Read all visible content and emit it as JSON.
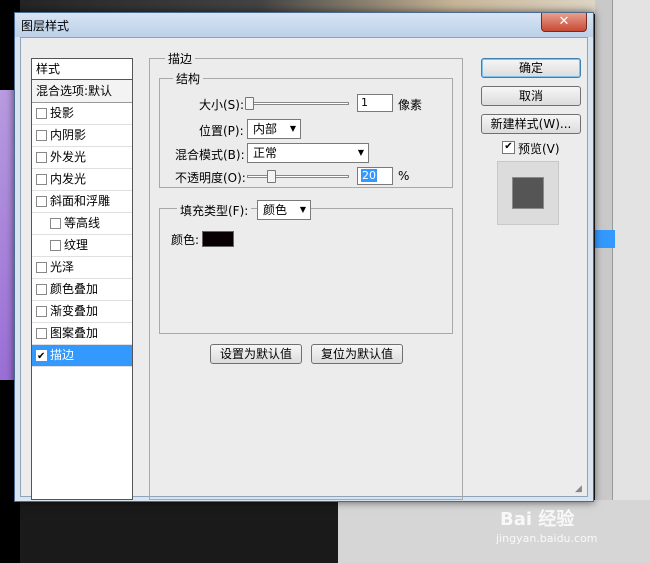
{
  "dialog": {
    "title": "图层样式",
    "close_label": "✕"
  },
  "styles_panel": {
    "header": "样式",
    "blend_options": "混合选项:默认",
    "items": [
      {
        "label": "投影",
        "checked": false,
        "indent": false,
        "selected": false
      },
      {
        "label": "内阴影",
        "checked": false,
        "indent": false,
        "selected": false
      },
      {
        "label": "外发光",
        "checked": false,
        "indent": false,
        "selected": false
      },
      {
        "label": "内发光",
        "checked": false,
        "indent": false,
        "selected": false
      },
      {
        "label": "斜面和浮雕",
        "checked": false,
        "indent": false,
        "selected": false
      },
      {
        "label": "等高线",
        "checked": false,
        "indent": true,
        "selected": false
      },
      {
        "label": "纹理",
        "checked": false,
        "indent": true,
        "selected": false
      },
      {
        "label": "光泽",
        "checked": false,
        "indent": false,
        "selected": false
      },
      {
        "label": "颜色叠加",
        "checked": false,
        "indent": false,
        "selected": false
      },
      {
        "label": "渐变叠加",
        "checked": false,
        "indent": false,
        "selected": false
      },
      {
        "label": "图案叠加",
        "checked": false,
        "indent": false,
        "selected": false
      },
      {
        "label": "描边",
        "checked": true,
        "indent": false,
        "selected": true
      }
    ]
  },
  "stroke": {
    "section_title": "描边",
    "structure_title": "结构",
    "size_label": "大小(S):",
    "size_value": "1",
    "size_unit": "像素",
    "position_label": "位置(P):",
    "position_value": "内部",
    "blend_mode_label": "混合模式(B):",
    "blend_mode_value": "正常",
    "opacity_label": "不透明度(O):",
    "opacity_value": "20",
    "opacity_unit": "%",
    "fill_type_label": "填充类型(F):",
    "fill_type_value": "颜色",
    "color_label": "颜色:",
    "color_value": "#080002",
    "set_default_button": "设置为默认值",
    "reset_default_button": "复位为默认值"
  },
  "actions": {
    "ok_button": "确定",
    "cancel_button": "取消",
    "new_style_button": "新建样式(W)...",
    "preview_label": "预览(V)",
    "preview_checked": true
  },
  "watermark": {
    "brand": "Bai 经验",
    "url": "jingyan.baidu.com"
  }
}
